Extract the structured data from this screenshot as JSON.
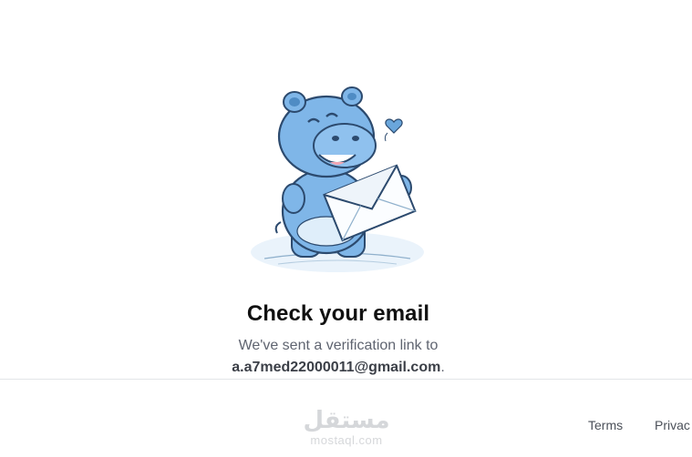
{
  "illustration": {
    "icon": "hippo-holding-envelope-illustration"
  },
  "main": {
    "title": "Check your email",
    "message_prefix": "We've sent a verification link to",
    "email": "a.a7med22000011@gmail.com",
    "message_suffix": "."
  },
  "watermark": {
    "arabic": "مستقل",
    "latin": "mostaql.com"
  },
  "footer": {
    "terms_label": "Terms",
    "privacy_label": "Privac"
  },
  "colors": {
    "hippo_blue": "#7fb6e8",
    "hippo_outline": "#2c4a6e",
    "title_text": "#111111",
    "body_text": "#5f6470"
  }
}
